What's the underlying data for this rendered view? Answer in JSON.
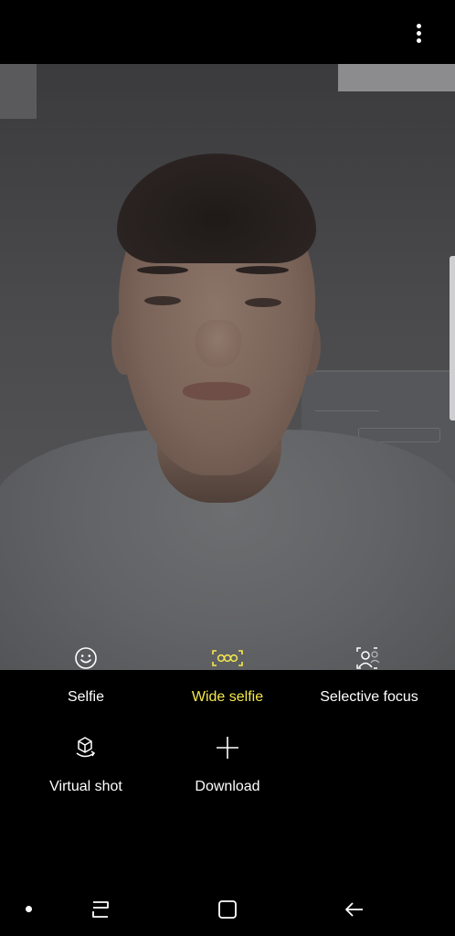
{
  "top_bar": {
    "menu_icon": "more-vertical-icon"
  },
  "viewfinder": {
    "mode_icons": [
      {
        "name": "smile-icon"
      },
      {
        "name": "wide-selfie-icon",
        "active_color": "#f5e94b"
      },
      {
        "name": "selective-focus-icon"
      }
    ]
  },
  "modes": [
    {
      "label": "Selfie",
      "active": false
    },
    {
      "label": "Wide selfie",
      "active": true
    },
    {
      "label": "Selective focus",
      "active": false
    }
  ],
  "extra_modes": [
    {
      "label": "Virtual shot",
      "icon": "virtual-shot-icon"
    },
    {
      "label": "Download",
      "icon": "plus-icon"
    }
  ],
  "nav": {
    "icons": [
      "recent-apps-icon",
      "home-icon",
      "back-arrow-icon"
    ]
  },
  "colors": {
    "active_mode": "#f5e94b",
    "background": "#000000",
    "text": "#ffffff"
  }
}
